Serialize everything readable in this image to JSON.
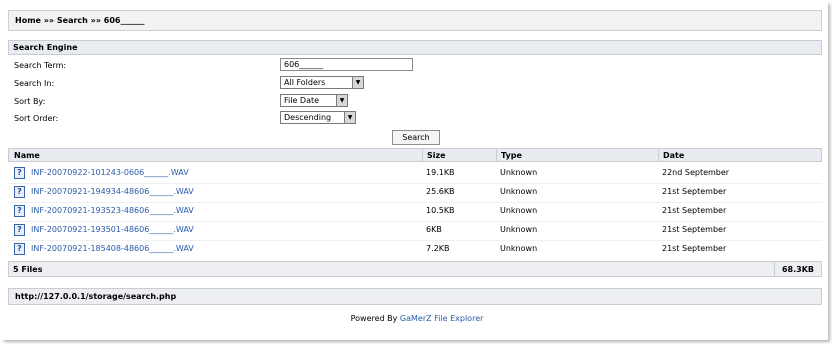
{
  "breadcrumb": {
    "home": "Home",
    "search": "Search",
    "term": "606______",
    "sep": "»"
  },
  "search_engine": {
    "title": "Search Engine",
    "labels": {
      "term": "Search Term:",
      "in": "Search In:",
      "sort_by": "Sort By:",
      "sort_order": "Sort Order:"
    },
    "values": {
      "term": "606______",
      "in": "All Folders",
      "sort_by": "File Date",
      "sort_order": "Descending"
    },
    "button": "Search"
  },
  "table": {
    "headers": {
      "name": "Name",
      "size": "Size",
      "type": "Type",
      "date": "Date"
    },
    "rows": [
      {
        "name": "INF-20070922-101243-0606______.WAV",
        "size": "19.1KB",
        "type": "Unknown",
        "date": "22nd September"
      },
      {
        "name": "INF-20070921-194934-48606______.WAV",
        "size": "25.6KB",
        "type": "Unknown",
        "date": "21st September"
      },
      {
        "name": "INF-20070921-193523-48606______.WAV",
        "size": "10.5KB",
        "type": "Unknown",
        "date": "21st September"
      },
      {
        "name": "INF-20070921-193501-48606______.WAV",
        "size": "6KB",
        "type": "Unknown",
        "date": "21st September"
      },
      {
        "name": "INF-20070921-185408-48606______.WAV",
        "size": "7.2KB",
        "type": "Unknown",
        "date": "21st September"
      }
    ],
    "footer": {
      "count": "5 Files",
      "total": "68.3KB"
    }
  },
  "url": "http://127.0.0.1/storage/search.php",
  "powered": {
    "prefix": "Powered By",
    "link": "GaMerZ File Explorer"
  },
  "icons": {
    "file": "unknown-file-icon",
    "dropdown": "dropdown-arrow-icon"
  },
  "colors": {
    "link": "#2a5ba8",
    "header_bg": "#e8ebef",
    "border": "#c9cdd3"
  }
}
